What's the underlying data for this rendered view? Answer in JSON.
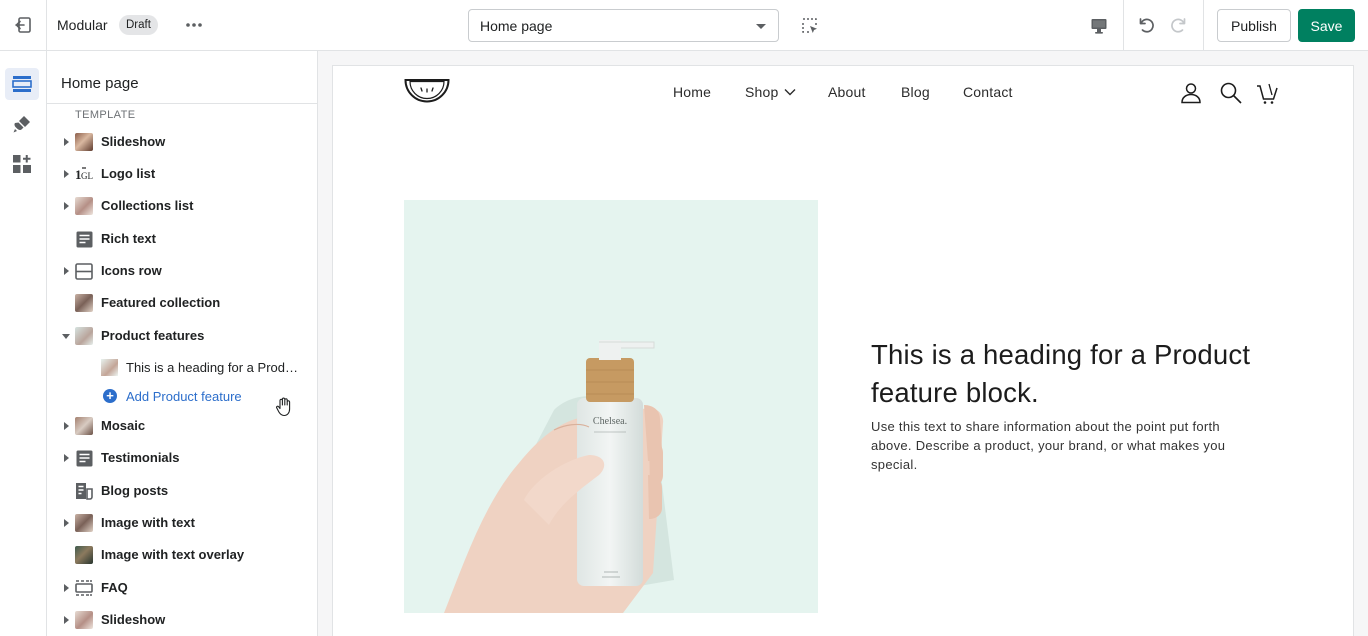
{
  "topbar": {
    "theme_name": "Modular",
    "status_badge": "Draft",
    "page_select": "Home page",
    "publish_label": "Publish",
    "save_label": "Save",
    "icons": [
      "exit-icon",
      "more-horizontal-icon",
      "inspector-icon",
      "desktop-icon",
      "undo-icon",
      "redo-icon"
    ]
  },
  "rail": {
    "items": [
      "sections-icon",
      "theme-settings-icon",
      "apps-icon"
    ],
    "active": "sections-icon"
  },
  "sidebar": {
    "title": "Home page",
    "template_label": "TEMPLATE",
    "sections": [
      {
        "label": "Slideshow",
        "expandable": true,
        "thumb": "photo"
      },
      {
        "label": "Logo list",
        "expandable": true,
        "thumb": "logo"
      },
      {
        "label": "Collections list",
        "expandable": true,
        "thumb": "photo"
      },
      {
        "label": "Rich text",
        "expandable": false,
        "thumb": "text-icon"
      },
      {
        "label": "Icons row",
        "expandable": true,
        "thumb": "columns-icon"
      },
      {
        "label": "Featured collection",
        "expandable": false,
        "thumb": "photo"
      },
      {
        "label": "Product features",
        "expandable": true,
        "expanded": true,
        "thumb": "photo"
      },
      {
        "label": "Mosaic",
        "expandable": true,
        "thumb": "photo"
      },
      {
        "label": "Testimonials",
        "expandable": true,
        "thumb": "text-icon"
      },
      {
        "label": "Blog posts",
        "expandable": false,
        "thumb": "blog-icon"
      },
      {
        "label": "Image with text",
        "expandable": true,
        "thumb": "photo"
      },
      {
        "label": "Image with text overlay",
        "expandable": false,
        "thumb": "photo"
      },
      {
        "label": "FAQ",
        "expandable": true,
        "thumb": "faq-icon"
      },
      {
        "label": "Slideshow",
        "expandable": true,
        "thumb": "photo"
      }
    ],
    "product_features_block": "This is a heading for a Product feature block.",
    "add_block_label": "Add Product feature"
  },
  "preview": {
    "nav": [
      "Home",
      "Shop",
      "About",
      "Blog",
      "Contact"
    ],
    "feature_heading": "This is a heading for a Product feature block.",
    "feature_text": "Use this text to share information about the point put forth above. Describe a product, your brand, or what makes you special.",
    "bottle_label": "Chelsea.",
    "colors": {
      "accent": "#008060",
      "image_bg": "#e5f4ef",
      "link": "#2c6ecb"
    }
  }
}
